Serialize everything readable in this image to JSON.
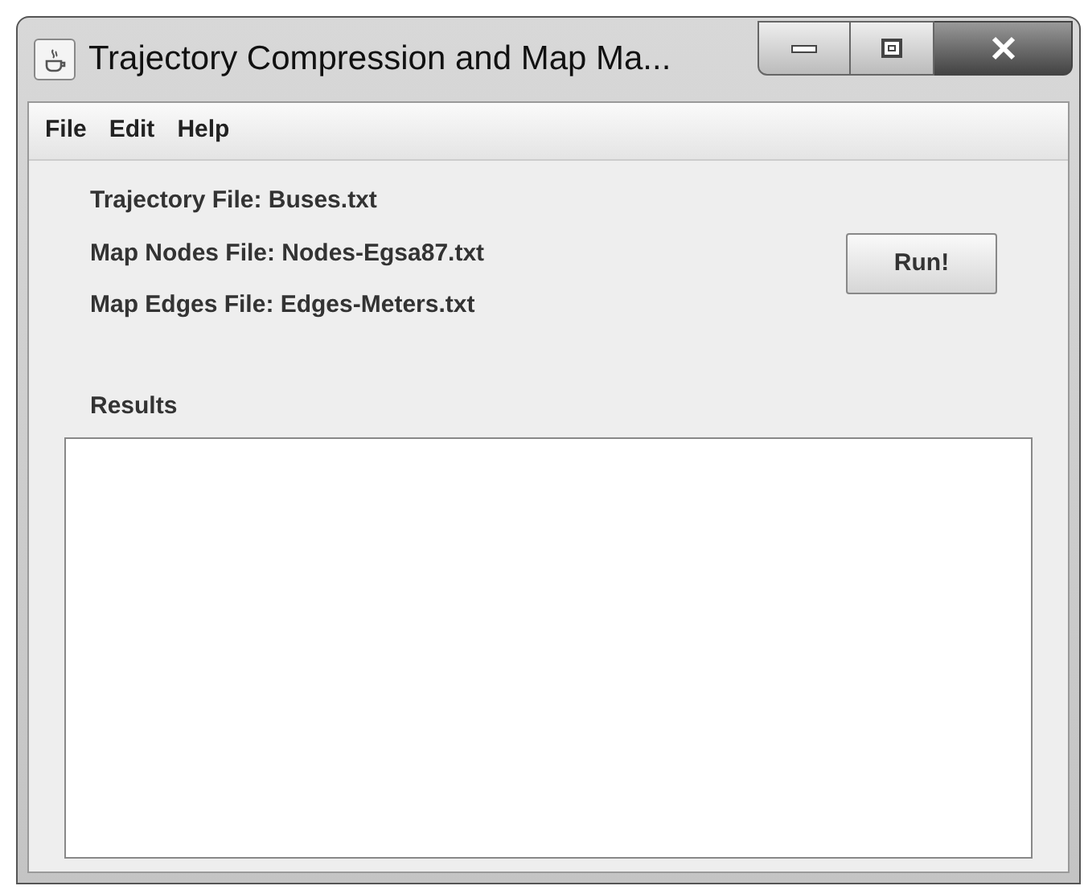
{
  "window": {
    "title": "Trajectory Compression and Map Ma..."
  },
  "menu": [
    "File",
    "Edit",
    "Help"
  ],
  "files": [
    "Trajectory File: Buses.txt",
    "Map Nodes File: Nodes-Egsa87.txt",
    "Map Edges File: Edges-Meters.txt"
  ],
  "run_button": "Run!",
  "results": {
    "label": "Results"
  }
}
